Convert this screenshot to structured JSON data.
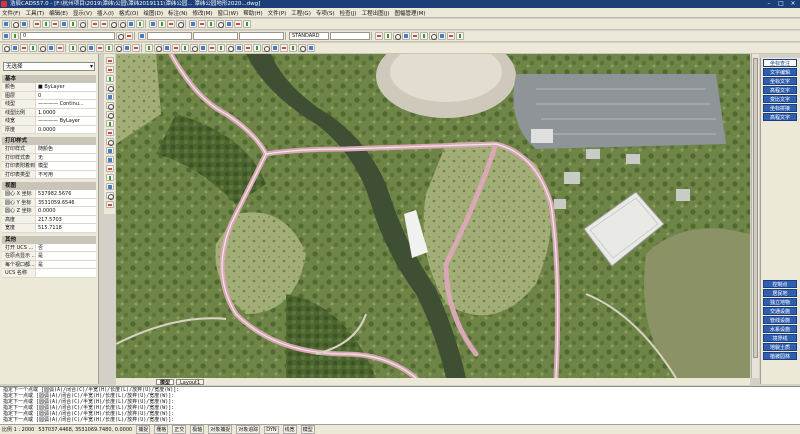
{
  "title": "浩辰CAD557.0 - [F:\\杭州项目\\2019\\潭纬\\公园\\潭纬2019111\\潭纬公园... 潭纬公园地形2020...dwg]",
  "menu": [
    "文件(F)",
    "工具(T)",
    "编辑(E)",
    "显示(V)",
    "插入(I)",
    "格式(O)",
    "绘图(D)",
    "标注(N)",
    "修改(M)",
    "窗口(W)",
    "帮助(H)",
    "文件(P)",
    "工程(G)",
    "专项(S)",
    "检查(J)",
    "工程出图(J)",
    "图幅管理(M)"
  ],
  "toolbar": {
    "style_combo": "STANDARD",
    "layer_combo": "0"
  },
  "properties": {
    "selection": "无选择",
    "sections": [
      {
        "title": "基本",
        "rows": [
          {
            "k": "颜色",
            "v": "■ ByLayer"
          },
          {
            "k": "图层",
            "v": "0"
          },
          {
            "k": "线型",
            "v": "———— Continu..."
          },
          {
            "k": "线型比例",
            "v": "1.0000"
          },
          {
            "k": "线宽",
            "v": "———— ByLayer"
          },
          {
            "k": "厚度",
            "v": "0.0000"
          }
        ]
      },
      {
        "title": "打印样式",
        "rows": [
          {
            "k": "打印样式",
            "v": "随颜色"
          },
          {
            "k": "打印样式表",
            "v": "无"
          },
          {
            "k": "打印表附着到",
            "v": "模型"
          },
          {
            "k": "打印表类型",
            "v": "不可用"
          }
        ]
      },
      {
        "title": "视图",
        "rows": [
          {
            "k": "圆心 X 坐标",
            "v": "537982.5676"
          },
          {
            "k": "圆心 Y 坐标",
            "v": "3531059.6546"
          },
          {
            "k": "圆心 Z 坐标",
            "v": "0.0000"
          },
          {
            "k": "高度",
            "v": "217.5703"
          },
          {
            "k": "宽度",
            "v": "515.7118"
          }
        ]
      },
      {
        "title": "其他",
        "rows": [
          {
            "k": "打开 UCS ...",
            "v": "否"
          },
          {
            "k": "在原点显示 ...",
            "v": "是"
          },
          {
            "k": "每个视口都...",
            "v": "是"
          },
          {
            "k": "UCS 名称",
            "v": ""
          }
        ]
      }
    ]
  },
  "right_palette": {
    "top": [
      "坐标查注",
      "文字编辑",
      "坐标文字",
      "高程文字",
      "变比文字",
      "坐标拼接",
      "高程文字"
    ],
    "bottom": [
      "控制点",
      "居民地",
      "独立地物",
      "交通设施",
      "管线设施",
      "水系设施",
      "境界线",
      "地貌土质",
      "植被园林"
    ]
  },
  "tabs": [
    "模型",
    "Layout1"
  ],
  "command_lines": [
    "指定下一个点或 [圆弧(A)/闭合(C)/半宽(H)/长度(L)/放弃(U)/宽度(W)]:",
    "指定下一点或 [圆弧(A)/闭合(C)/半宽(H)/长度(L)/放弃(U)/宽度(W)]:",
    "指定下一点或 [圆弧(A)/闭合(C)/半宽(H)/长度(L)/放弃(U)/宽度(W)]:",
    "指定下一点或 [圆弧(A)/闭合(C)/半宽(H)/长度(L)/放弃(U)/宽度(W)]:",
    "指定下一点或 [圆弧(A)/闭合(C)/半宽(H)/长度(L)/放弃(U)/宽度(W)]:",
    "指定下一点或 [圆弧(A)/闭合(C)/半宽(H)/长度(L)/放弃(U)/宽度(W)]:"
  ],
  "status": {
    "scale": "比例 1 : 2000",
    "coords": "537037.4468, 3531069.7480, 0.0000",
    "toggles": [
      "捕捉",
      "栅格",
      "正交",
      "极轴",
      "对象捕捉",
      "对象追踪",
      "DYN",
      "线宽",
      "模型"
    ]
  },
  "colors": {
    "road": "#d8a8b4",
    "water": "#3e4f33",
    "accent": "#2f5fb0"
  }
}
